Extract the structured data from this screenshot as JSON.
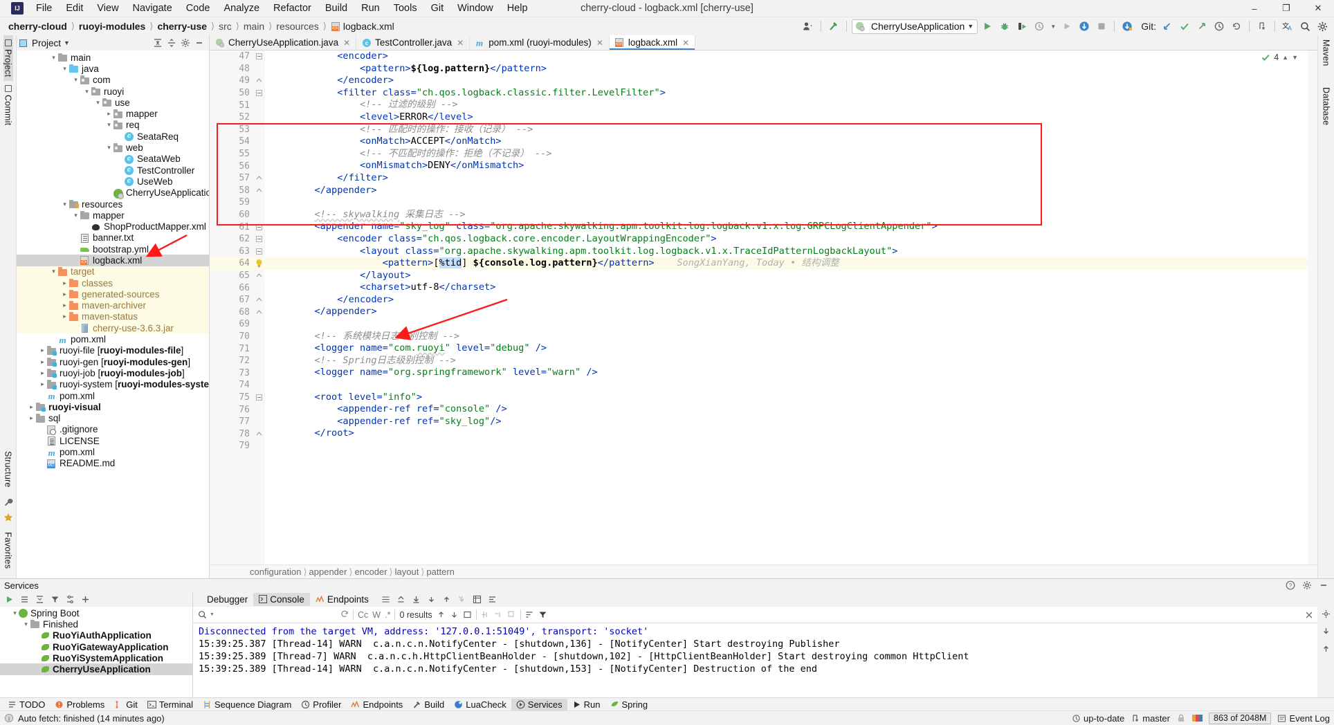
{
  "window": {
    "title": "cherry-cloud - logback.xml [cherry-use]",
    "minimize": "–",
    "maximize": "❐",
    "close": "✕"
  },
  "menubar": [
    {
      "label": "File"
    },
    {
      "label": "Edit"
    },
    {
      "label": "View"
    },
    {
      "label": "Navigate"
    },
    {
      "label": "Code"
    },
    {
      "label": "Analyze"
    },
    {
      "label": "Refactor"
    },
    {
      "label": "Build"
    },
    {
      "label": "Run"
    },
    {
      "label": "Tools"
    },
    {
      "label": "Git"
    },
    {
      "label": "Window"
    },
    {
      "label": "Help"
    }
  ],
  "breadcrumbs": [
    {
      "label": "cherry-cloud",
      "bold": true
    },
    {
      "label": "ruoyi-modules",
      "bold": true
    },
    {
      "label": "cherry-use",
      "bold": true
    },
    {
      "label": "src",
      "bold": false
    },
    {
      "label": "main",
      "bold": false
    },
    {
      "label": "resources",
      "bold": false
    },
    {
      "label": "logback.xml",
      "bold": false,
      "icon": "xml-file-icon"
    }
  ],
  "toolbar": {
    "run_configuration": "CherryUseApplication",
    "git_label": "Git:",
    "icons": [
      "user-avatar-icon",
      "hammer-build-icon",
      "run-icon",
      "debug-icon",
      "run-with-coverage-icon",
      "profiler-icon",
      "rerun-icon",
      "stop-icon",
      "update-project-icon",
      "commit-icon",
      "push-icon",
      "history-icon",
      "rollback-icon",
      "branch-icon",
      "translate-icon",
      "search-everywhere-icon",
      "settings-gear-icon"
    ]
  },
  "left_rail": [
    {
      "label": "Project",
      "selected": true
    },
    {
      "label": "Commit",
      "selected": false
    },
    {
      "label": "Structure",
      "selected": false
    },
    {
      "label": "Favorites",
      "selected": false
    }
  ],
  "right_rail": [
    {
      "label": "Maven"
    },
    {
      "label": "Database"
    }
  ],
  "project_panel": {
    "title": "Project",
    "tools": [
      "collapse-all-icon",
      "expand-all-icon",
      "settings-gear-icon",
      "hide-icon"
    ],
    "tree": [
      {
        "indent": 3,
        "arrow": "v",
        "icon": "folder-grey",
        "label": "main"
      },
      {
        "indent": 4,
        "arrow": "v",
        "icon": "folder-blue",
        "label": "java"
      },
      {
        "indent": 5,
        "arrow": "v",
        "icon": "folder-pkg",
        "label": "com"
      },
      {
        "indent": 6,
        "arrow": "v",
        "icon": "folder-pkg",
        "label": "ruoyi"
      },
      {
        "indent": 7,
        "arrow": "v",
        "icon": "folder-pkg",
        "label": "use"
      },
      {
        "indent": 8,
        "arrow": ">",
        "icon": "folder-pkg",
        "label": "mapper"
      },
      {
        "indent": 8,
        "arrow": "v",
        "icon": "folder-pkg",
        "label": "req"
      },
      {
        "indent": 9,
        "arrow": "",
        "icon": "java-class",
        "label": "SeataReq"
      },
      {
        "indent": 8,
        "arrow": "v",
        "icon": "folder-pkg",
        "label": "web"
      },
      {
        "indent": 9,
        "arrow": "",
        "icon": "java-class",
        "label": "SeataWeb"
      },
      {
        "indent": 9,
        "arrow": "",
        "icon": "java-class",
        "label": "TestController"
      },
      {
        "indent": 9,
        "arrow": "",
        "icon": "java-class",
        "label": "UseWeb"
      },
      {
        "indent": 8,
        "arrow": "",
        "icon": "spring-boot-class",
        "label": "CherryUseApplication"
      },
      {
        "indent": 4,
        "arrow": "v",
        "icon": "folder-resources",
        "label": "resources"
      },
      {
        "indent": 5,
        "arrow": "v",
        "icon": "folder-grey",
        "label": "mapper"
      },
      {
        "indent": 6,
        "arrow": "",
        "icon": "mybatis-file",
        "label": "ShopProductMapper.xml"
      },
      {
        "indent": 5,
        "arrow": "",
        "icon": "text-file",
        "label": "banner.txt"
      },
      {
        "indent": 5,
        "arrow": "",
        "icon": "yaml-file",
        "label": "bootstrap.yml"
      },
      {
        "indent": 5,
        "arrow": "",
        "icon": "xml-file",
        "label": "logback.xml",
        "selected": true
      },
      {
        "indent": 3,
        "arrow": "v",
        "icon": "folder-orange",
        "label": "target",
        "excluded": true
      },
      {
        "indent": 4,
        "arrow": ">",
        "icon": "folder-orange",
        "label": "classes",
        "excluded": true
      },
      {
        "indent": 4,
        "arrow": ">",
        "icon": "folder-orange",
        "label": "generated-sources",
        "excluded": true
      },
      {
        "indent": 4,
        "arrow": ">",
        "icon": "folder-orange",
        "label": "maven-archiver",
        "excluded": true
      },
      {
        "indent": 4,
        "arrow": ">",
        "icon": "folder-orange",
        "label": "maven-status",
        "excluded": true
      },
      {
        "indent": 5,
        "arrow": "",
        "icon": "jar-file",
        "label": "cherry-use-3.6.3.jar",
        "excluded": true
      },
      {
        "indent": 3,
        "arrow": "",
        "icon": "maven-pom",
        "label": "pom.xml"
      },
      {
        "indent": 2,
        "arrow": ">",
        "icon": "folder-module",
        "label": "ruoyi-file [ruoyi-modules-file]",
        "module": "ruoyi-file",
        "modbold": "ruoyi-modules-file"
      },
      {
        "indent": 2,
        "arrow": ">",
        "icon": "folder-module",
        "label": "ruoyi-gen [ruoyi-modules-gen]",
        "module": "ruoyi-gen",
        "modbold": "ruoyi-modules-gen"
      },
      {
        "indent": 2,
        "arrow": ">",
        "icon": "folder-module",
        "label": "ruoyi-job [ruoyi-modules-job]",
        "module": "ruoyi-job",
        "modbold": "ruoyi-modules-job"
      },
      {
        "indent": 2,
        "arrow": ">",
        "icon": "folder-module",
        "label": "ruoyi-system [ruoyi-modules-system]",
        "module": "ruoyi-system",
        "modbold": "ruoyi-modules-system"
      },
      {
        "indent": 2,
        "arrow": "",
        "icon": "maven-pom",
        "label": "pom.xml"
      },
      {
        "indent": 1,
        "arrow": ">",
        "icon": "folder-module",
        "label": "ruoyi-visual",
        "bold": true
      },
      {
        "indent": 1,
        "arrow": ">",
        "icon": "folder-grey",
        "label": "sql"
      },
      {
        "indent": 2,
        "arrow": "",
        "icon": "gitignore-file",
        "label": ".gitignore"
      },
      {
        "indent": 2,
        "arrow": "",
        "icon": "license-file",
        "label": "LICENSE"
      },
      {
        "indent": 2,
        "arrow": "",
        "icon": "maven-pom",
        "label": "pom.xml"
      },
      {
        "indent": 2,
        "arrow": "",
        "icon": "markdown-file",
        "label": "README.md"
      }
    ]
  },
  "editor": {
    "tabs": [
      {
        "label": "CherryUseApplication.java",
        "icon": "spring-boot-class",
        "active": false,
        "close": "✕"
      },
      {
        "label": "TestController.java",
        "icon": "java-class",
        "active": false,
        "close": "✕"
      },
      {
        "label": "pom.xml (ruoyi-modules)",
        "icon": "maven-pom",
        "active": false,
        "close": "✕"
      },
      {
        "label": "logback.xml",
        "icon": "xml-file",
        "active": true,
        "close": "✕"
      }
    ],
    "inspection_count": "4",
    "first_line": 47,
    "lines": [
      {
        "n": 47,
        "fold": "v",
        "html": "            <span class='tagp'>&lt;encoder&gt;</span>"
      },
      {
        "n": 48,
        "fold": "",
        "html": "                <span class='tagp'>&lt;pattern&gt;</span><span class='tmpl'>${log.pattern}</span><span class='tagp'>&lt;/pattern&gt;</span>"
      },
      {
        "n": 49,
        "fold": "^",
        "html": "            <span class='tagp'>&lt;/encoder&gt;</span>"
      },
      {
        "n": 50,
        "fold": "v",
        "html": "            <span class='tagp'>&lt;filter</span> <span class='attr'>class=</span><span class='val'>\"ch.qos.logback.classic.filter.LevelFilter\"</span><span class='tagp'>&gt;</span>"
      },
      {
        "n": 51,
        "fold": "",
        "html": "                <span class='cmt'>&lt;!-- 过滤的级别 --&gt;</span>"
      },
      {
        "n": 52,
        "fold": "",
        "html": "                <span class='tagp'>&lt;level&gt;</span><span class='txt'>ERROR</span><span class='tagp'>&lt;/level&gt;</span>"
      },
      {
        "n": 53,
        "fold": "",
        "html": "                <span class='cmt'>&lt;!-- 匹配时的操作：接收（记录） --&gt;</span>"
      },
      {
        "n": 54,
        "fold": "",
        "html": "                <span class='tagp'>&lt;onMatch&gt;</span><span class='txt'>ACCEPT</span><span class='tagp'>&lt;/onMatch&gt;</span>"
      },
      {
        "n": 55,
        "fold": "",
        "html": "                <span class='cmt'>&lt;!-- 不匹配时的操作：拒绝（不记录） --&gt;</span>"
      },
      {
        "n": 56,
        "fold": "",
        "html": "                <span class='tagp'>&lt;onMismatch&gt;</span><span class='txt'>DENY</span><span class='tagp'>&lt;/onMismatch&gt;</span>"
      },
      {
        "n": 57,
        "fold": "^",
        "html": "            <span class='tagp'>&lt;/filter&gt;</span>"
      },
      {
        "n": 58,
        "fold": "^",
        "html": "        <span class='tagp'>&lt;/appender&gt;</span>"
      },
      {
        "n": 59,
        "fold": "",
        "html": ""
      },
      {
        "n": 60,
        "fold": "",
        "html": "        <span class='cmt'><span class='wavy'>&lt;!-- skywalking</span> 采集日志 --&gt;</span>"
      },
      {
        "n": 61,
        "fold": "v",
        "html": "        <span class='tagp'>&lt;appender</span> <span class='attr'>name=</span><span class='val'>\"sky_log\"</span> <span class='attr'>class=</span><span class='val'>\"org.apache.skywalking.apm.toolkit.log.logback.v1.x.log.GRPCLogClientAppender\"</span><span class='tagp'>&gt;</span>"
      },
      {
        "n": 62,
        "fold": "v",
        "html": "            <span class='tagp'>&lt;encoder</span> <span class='attr'>class=</span><span class='val'>\"ch.qos.logback.core.encoder.LayoutWrappingEncoder\"</span><span class='tagp'>&gt;</span>"
      },
      {
        "n": 63,
        "fold": "v",
        "html": "                <span class='tagp'>&lt;layout</span> <span class='attr'>class=</span><span class='val'>\"org.apache.skywalking.apm.toolkit.log.logback.v1.x.TraceIdPatternLogbackLayout\"</span><span class='tagp'>&gt;</span>"
      },
      {
        "n": 64,
        "fold": "bulb",
        "hl": true,
        "html": "                    <span class='tagp'>&lt;pattern&gt;</span><span class='txt'>[</span><span class='sel-tok txt'>%tid</span><span class='txt'>] </span><span class='tmpl'>${console.log.pattern}</span><span class='tagp'>&lt;/pattern&gt;</span>    <span class='annot'>SongXianYang, Today • 结构调整</span>"
      },
      {
        "n": 65,
        "fold": "^",
        "html": "                <span class='tagp'>&lt;/layout&gt;</span>"
      },
      {
        "n": 66,
        "fold": "",
        "html": "                <span class='tagp'>&lt;charset&gt;</span><span class='txt'>utf-8</span><span class='tagp'>&lt;/charset&gt;</span>"
      },
      {
        "n": 67,
        "fold": "^",
        "html": "            <span class='tagp'>&lt;/encoder&gt;</span>"
      },
      {
        "n": 68,
        "fold": "^",
        "html": "        <span class='tagp'>&lt;/appender&gt;</span>"
      },
      {
        "n": 69,
        "fold": "",
        "html": ""
      },
      {
        "n": 70,
        "fold": "",
        "html": "        <span class='cmt'>&lt;!-- 系统模块日志级别控制 --&gt;</span>"
      },
      {
        "n": 71,
        "fold": "",
        "html": "        <span class='tagp'>&lt;logger</span> <span class='attr'>name=</span><span class='val'>\"com.<span class='wavy'>ruoyi</span>\"</span> <span class='attr'>level=</span><span class='val'>\"debug\"</span> <span class='tagp'>/&gt;</span>"
      },
      {
        "n": 72,
        "fold": "",
        "html": "        <span class='cmt'>&lt;!-- Spring日志级别控制 --&gt;</span>"
      },
      {
        "n": 73,
        "fold": "",
        "html": "        <span class='tagp'>&lt;logger</span> <span class='attr'>name=</span><span class='val'>\"org.springframework\"</span> <span class='attr'>level=</span><span class='val'>\"warn\"</span> <span class='tagp'>/&gt;</span>"
      },
      {
        "n": 74,
        "fold": "",
        "html": ""
      },
      {
        "n": 75,
        "fold": "v",
        "html": "        <span class='tagp'>&lt;root</span> <span class='attr'>level=</span><span class='val'>\"info\"</span><span class='tagp'>&gt;</span>"
      },
      {
        "n": 76,
        "fold": "",
        "html": "            <span class='tagp'>&lt;appender-ref</span> <span class='attr'>ref=</span><span class='val'>\"console\"</span> <span class='tagp'>/&gt;</span>"
      },
      {
        "n": 77,
        "fold": "",
        "html": "            <span class='tagp'>&lt;appender-ref</span> <span class='attr'>ref=</span><span class='val'>\"sky_log\"</span><span class='tagp'>/&gt;</span>"
      },
      {
        "n": 78,
        "fold": "^",
        "html": "        <span class='tagp'>&lt;/root&gt;</span>"
      },
      {
        "n": 79,
        "fold": "",
        "html": ""
      }
    ],
    "status_breadcrumbs": [
      "configuration",
      "appender",
      "encoder",
      "layout",
      "pattern"
    ]
  },
  "services": {
    "title": "Services",
    "toolbar_icons": [
      "run-icon",
      "filter-icon",
      "expand-icon",
      "collapse-icon",
      "settings-icon",
      "add-icon"
    ],
    "title_right_icons": [
      "help-icon",
      "settings-gear-icon",
      "minimize-icon"
    ],
    "tree": [
      {
        "indent": 1,
        "arrow": "v",
        "icon": "spring-icon",
        "label": "Spring Boot",
        "bold": false
      },
      {
        "indent": 2,
        "arrow": "v",
        "icon": "folder-grey",
        "label": "Finished",
        "bold": false
      },
      {
        "indent": 3,
        "arrow": "",
        "icon": "spring-leaf",
        "label": "RuoYiAuthApplication",
        "bold": true
      },
      {
        "indent": 3,
        "arrow": "",
        "icon": "spring-leaf",
        "label": "RuoYiGatewayApplication",
        "bold": true
      },
      {
        "indent": 3,
        "arrow": "",
        "icon": "spring-leaf",
        "label": "RuoYiSystemApplication",
        "bold": true
      },
      {
        "indent": 3,
        "arrow": "",
        "icon": "spring-leaf",
        "label": "CherryUseApplication",
        "bold": true,
        "selected": true
      }
    ]
  },
  "console": {
    "tabs": [
      {
        "label": "Debugger",
        "icon": "debugger-icon",
        "active": false
      },
      {
        "label": "Console",
        "icon": "console-icon",
        "active": true
      },
      {
        "label": "Endpoints",
        "icon": "endpoints-icon",
        "active": false
      }
    ],
    "search_placeholder": "",
    "search_value": "",
    "results_label": "0 results",
    "match_case": "Cc",
    "words": "W",
    "regex": ".*",
    "lines": [
      {
        "cls": "co-blue",
        "text": "Disconnected from the target VM, address: '127.0.0.1:51049', transport: 'socket'"
      },
      {
        "cls": "",
        "text": "15:39:25.387 [Thread-14] WARN  c.a.n.c.n.NotifyCenter - [shutdown,136] - [NotifyCenter] Start destroying Publisher"
      },
      {
        "cls": "",
        "text": "15:39:25.389 [Thread-7] WARN  c.a.n.c.h.HttpClientBeanHolder - [shutdown,102] - [HttpClientBeanHolder] Start destroying common HttpClient"
      },
      {
        "cls": "",
        "text": "15:39:25.389 [Thread-14] WARN  c.a.n.c.n.NotifyCenter - [shutdown,153] - [NotifyCenter] Destruction of the end"
      }
    ]
  },
  "toolwindow_bar": [
    {
      "label": "TODO",
      "icon": "todo-icon",
      "active": false
    },
    {
      "label": "Problems",
      "icon": "problems-icon",
      "active": false
    },
    {
      "label": "Git",
      "icon": "git-icon",
      "active": false
    },
    {
      "label": "Terminal",
      "icon": "terminal-icon",
      "active": false
    },
    {
      "label": "Sequence Diagram",
      "icon": "sequence-diagram-icon",
      "active": false
    },
    {
      "label": "Profiler",
      "icon": "profiler-icon",
      "active": false
    },
    {
      "label": "Endpoints",
      "icon": "endpoints-icon",
      "active": false
    },
    {
      "label": "Build",
      "icon": "build-icon",
      "active": false
    },
    {
      "label": "LuaCheck",
      "icon": "luacheck-icon",
      "active": false
    },
    {
      "label": "Services",
      "icon": "services-icon",
      "active": true
    },
    {
      "label": "Run",
      "icon": "run-icon",
      "active": false
    },
    {
      "label": "Spring",
      "icon": "spring-icon",
      "active": false
    }
  ],
  "statusbar": {
    "message": "Auto fetch: finished (14 minutes ago)",
    "git_status": "up-to-date",
    "branch": "master",
    "memory": "863 of 2048M",
    "event_log": "Event Log"
  }
}
